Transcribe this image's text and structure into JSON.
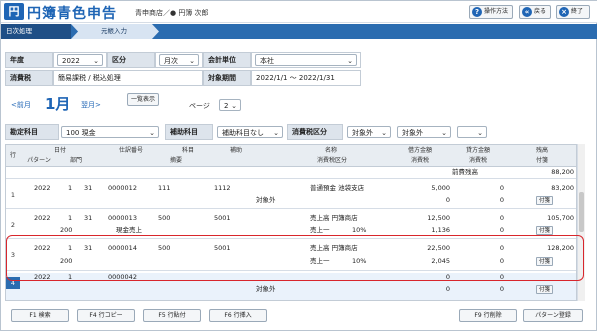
{
  "app": {
    "logo_char": "円",
    "title": "円簿青色申告",
    "store": "青申商店／● 円簿 次郎"
  },
  "toolbar": {
    "help_label": "操作方法",
    "back_label": "戻る",
    "exit_label": "終了",
    "help_icon": "?",
    "back_icon": "«",
    "exit_icon": "×"
  },
  "tabs": [
    {
      "label": "日次処理"
    },
    {
      "label": "元帳入力"
    }
  ],
  "filters": {
    "year_label": "年度",
    "year_value": "2022",
    "period_label": "区分",
    "period_value": "月次",
    "unit_label": "会計単位",
    "unit_value": "本社",
    "tax_label": "消費税",
    "tax_value": "簡易課税 / 税込処理",
    "term_label": "対象期間",
    "term_value": "2022/1/1 ～ 2022/1/31"
  },
  "month_nav": {
    "prev": "<前月",
    "current": "1月",
    "next": "翌月>",
    "list_button": "一覧表示",
    "page_label": "ページ",
    "page_value": "2"
  },
  "account_bar": {
    "account_label": "勘定科目",
    "account_value": "100 現金",
    "sub_label": "補助科目",
    "sub_value": "補助科目なし",
    "tax_label": "消費税区分",
    "tax_value1": "対象外",
    "tax_value2": "対象外"
  },
  "grid": {
    "headers_top": [
      "日付",
      "仕訳番号",
      "科目",
      "補助",
      "名称",
      "借方金額",
      "貸方金額",
      "残高"
    ],
    "headers_bottom": [
      "パターン",
      "部門",
      "摘要",
      "消費税区分",
      "消費税",
      "消費税",
      "付箋"
    ],
    "row_label": "行",
    "carry_label": "前費残高",
    "carry_value": "88,200",
    "fuseni_label": "付箋",
    "rows": [
      {
        "num": "1",
        "year": "2022",
        "month": "1",
        "day": "31",
        "no": "0000012",
        "acct": "111",
        "sub": "1112",
        "name": "普通預金 池袋支店",
        "debit": "5,000",
        "credit": "0",
        "balance": "83,200",
        "pattern": "",
        "dept": "",
        "memo": "",
        "tax_cat": "対象外",
        "tax_rate": "",
        "debit_tax": "0",
        "credit_tax": "0"
      },
      {
        "num": "2",
        "year": "2022",
        "month": "1",
        "day": "31",
        "no": "0000013",
        "acct": "500",
        "sub": "5001",
        "name": "売上高 円簿商店",
        "debit": "12,500",
        "credit": "0",
        "balance": "105,700",
        "pattern": "200",
        "dept": "",
        "memo": "現金売上",
        "tax_cat": "売上一",
        "tax_rate": "10%",
        "debit_tax": "1,136",
        "credit_tax": "0"
      },
      {
        "num": "3",
        "year": "2022",
        "month": "1",
        "day": "31",
        "no": "0000014",
        "acct": "500",
        "sub": "5001",
        "name": "売上高 円簿商店",
        "debit": "22,500",
        "credit": "0",
        "balance": "128,200",
        "pattern": "200",
        "dept": "",
        "memo": "",
        "tax_cat": "売上一",
        "tax_rate": "10%",
        "debit_tax": "2,045",
        "credit_tax": "0"
      },
      {
        "num": "4",
        "year": "2022",
        "month": "1",
        "day": "",
        "no": "0000042",
        "acct": "",
        "sub": "",
        "name": "",
        "debit": "0",
        "credit": "0",
        "balance": "",
        "pattern": "",
        "dept": "",
        "memo": "",
        "tax_cat": "対象外",
        "tax_rate": "",
        "debit_tax": "0",
        "credit_tax": "0"
      }
    ]
  },
  "fkeys": {
    "f1": "F1 検索",
    "f4": "F4 行コピー",
    "f5": "F5 行貼付",
    "f6": "F6 行挿入",
    "f9": "F9 行削除",
    "pattern": "パターン登録"
  },
  "colors": {
    "brand": "#1f65b5",
    "tab_active": "#1f4f86",
    "highlight": "#d8262c"
  }
}
